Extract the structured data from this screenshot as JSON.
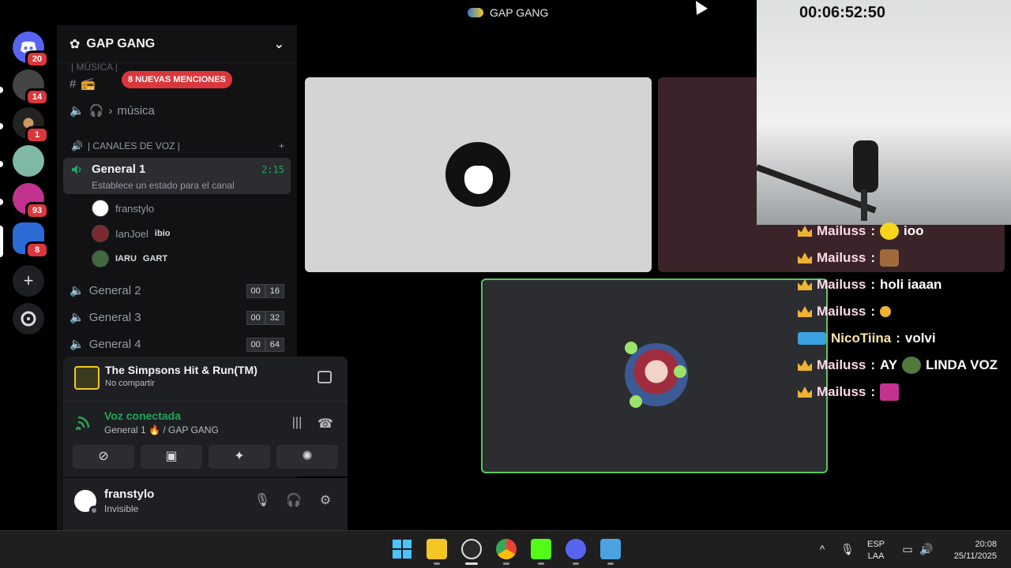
{
  "window": {
    "title": "GAP GANG"
  },
  "rail": {
    "home_badge": "20",
    "servers": [
      {
        "badge": "14"
      },
      {
        "badge": "1"
      },
      {
        "badge": ""
      },
      {
        "badge": "93"
      },
      {
        "badge": "8"
      }
    ]
  },
  "sidebar": {
    "server_name": "GAP GANG",
    "top_partial": "| MÚSICA |",
    "mention_pill": "8 NUEVAS MENCIONES",
    "music_channel": "música",
    "voice_category": "| CANALES DE VOZ |",
    "active_channel": {
      "name": "General 1",
      "time": "2:15",
      "status": "Establece un estado para el canal"
    },
    "members": [
      {
        "name": "franstylo",
        "tag": ""
      },
      {
        "name": "IanJoel",
        "tag": "ibio"
      },
      {
        "name": "IARU",
        "tag": "GART"
      }
    ],
    "other_channels": [
      {
        "name": "General 2",
        "c1": "00",
        "c2": "16"
      },
      {
        "name": "General 3",
        "c1": "00",
        "c2": "32"
      },
      {
        "name": "General 4",
        "c1": "00",
        "c2": "64"
      }
    ]
  },
  "activity": {
    "game_title": "The Simpsons Hit & Run(TM)",
    "game_sub": "No compartir"
  },
  "voice": {
    "status": "Voz conectada",
    "channel": "General 1",
    "server": "/ GAP GANG"
  },
  "user": {
    "name": "franstylo",
    "status": "Invisible"
  },
  "overlay": {
    "clock": "00:06:52:50",
    "messages": [
      {
        "user": "Mailuss",
        "text": "ioo"
      },
      {
        "user": "Mailuss",
        "text": ""
      },
      {
        "user": "Mailuss",
        "text": "holi iaaan"
      },
      {
        "user": "Mailuss",
        "text": ""
      },
      {
        "user": "NicoTiina",
        "text": "volvi"
      },
      {
        "user": "Mailuss",
        "text": "AY"
      },
      {
        "user": "Mailuss",
        "text": ""
      }
    ],
    "msg6_tail": "LINDA VOZ"
  },
  "taskbar": {
    "lang1": "ESP",
    "lang2": "LAA",
    "time": "20:08",
    "date": "25/11/2025"
  }
}
